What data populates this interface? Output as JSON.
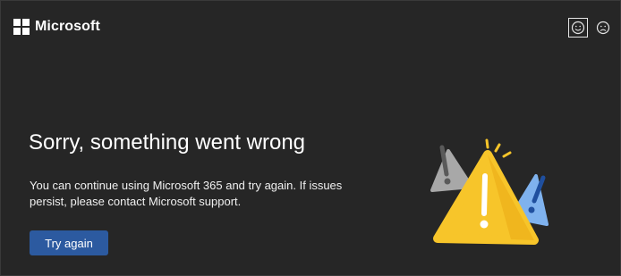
{
  "brand": {
    "name": "Microsoft",
    "logo_color": "#ffffff"
  },
  "feedback": {
    "happy_icon": "smile-icon",
    "sad_icon": "frown-icon"
  },
  "error": {
    "title": "Sorry, something went wrong",
    "message": "You can continue using Microsoft 365 and try again. If issues persist, please contact Microsoft support.",
    "retry_label": "Try again"
  },
  "colors": {
    "background": "#262626",
    "button": "#2c5aa0",
    "warning_yellow": "#f5c518",
    "warning_blue": "#6aa7e8",
    "warning_gray": "#9a9a9a"
  }
}
